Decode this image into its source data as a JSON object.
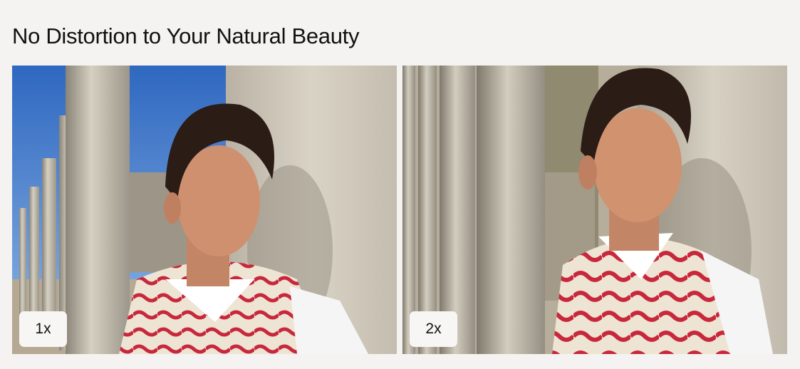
{
  "page": {
    "title": "No Distortion to Your Natural Beauty"
  },
  "comparison": {
    "photos": [
      {
        "zoom_label": "1x"
      },
      {
        "zoom_label": "2x"
      }
    ]
  },
  "colors": {
    "background": "#f4f3f1",
    "sky": "#3e78c8",
    "stone": "#c9c3b6",
    "sweater": "#efe6d8",
    "sweater_pattern": "#c8283c",
    "hair": "#2b1c15",
    "skin": "#c98a6a"
  }
}
